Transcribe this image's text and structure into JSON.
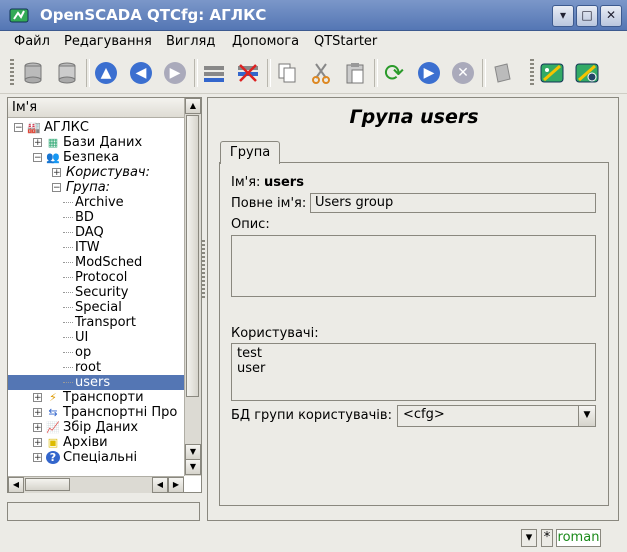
{
  "window": {
    "title": "OpenSCADA QTCfg: АГЛКС",
    "buttons": [
      "▾",
      "□",
      "✕"
    ]
  },
  "menu": [
    "Файл",
    "Редагування",
    "Вигляд",
    "Допомога",
    "QTStarter"
  ],
  "toolbar": {
    "icons": [
      "db-load-icon",
      "db-save-icon",
      "up-icon",
      "back-icon",
      "forward-icon",
      "add-item-icon",
      "delete-item-icon",
      "copy-icon",
      "cut-icon",
      "paste-icon",
      "refresh-icon",
      "start-icon",
      "stop-icon",
      "help-icon",
      "qtstarter-icon",
      "qtcfg-icon"
    ]
  },
  "tree": {
    "header": "Ім'я",
    "items": [
      {
        "label": "АГЛКС",
        "level": 0,
        "expander": "−",
        "icon": "station-icon",
        "italic": false,
        "selected": false
      },
      {
        "label": "Бази Даних",
        "level": 1,
        "expander": "+",
        "icon": "database-icon",
        "italic": false,
        "selected": false
      },
      {
        "label": "Безпека",
        "level": 1,
        "expander": "−",
        "icon": "security-icon",
        "italic": false,
        "selected": false
      },
      {
        "label": "Користувач:",
        "level": 2,
        "expander": "+",
        "icon": "",
        "italic": true,
        "selected": false
      },
      {
        "label": "Група:",
        "level": 2,
        "expander": "−",
        "icon": "",
        "italic": true,
        "selected": false
      },
      {
        "label": "Archive",
        "level": 3,
        "expander": "",
        "icon": "",
        "italic": false,
        "selected": false
      },
      {
        "label": "BD",
        "level": 3,
        "expander": "",
        "icon": "",
        "italic": false,
        "selected": false
      },
      {
        "label": "DAQ",
        "level": 3,
        "expander": "",
        "icon": "",
        "italic": false,
        "selected": false
      },
      {
        "label": "ITW",
        "level": 3,
        "expander": "",
        "icon": "",
        "italic": false,
        "selected": false
      },
      {
        "label": "ModSched",
        "level": 3,
        "expander": "",
        "icon": "",
        "italic": false,
        "selected": false
      },
      {
        "label": "Protocol",
        "level": 3,
        "expander": "",
        "icon": "",
        "italic": false,
        "selected": false
      },
      {
        "label": "Security",
        "level": 3,
        "expander": "",
        "icon": "",
        "italic": false,
        "selected": false
      },
      {
        "label": "Special",
        "level": 3,
        "expander": "",
        "icon": "",
        "italic": false,
        "selected": false
      },
      {
        "label": "Transport",
        "level": 3,
        "expander": "",
        "icon": "",
        "italic": false,
        "selected": false
      },
      {
        "label": "UI",
        "level": 3,
        "expander": "",
        "icon": "",
        "italic": false,
        "selected": false
      },
      {
        "label": "op",
        "level": 3,
        "expander": "",
        "icon": "",
        "italic": false,
        "selected": false
      },
      {
        "label": "root",
        "level": 3,
        "expander": "",
        "icon": "",
        "italic": false,
        "selected": false
      },
      {
        "label": "users",
        "level": 3,
        "expander": "",
        "icon": "",
        "italic": false,
        "selected": true
      },
      {
        "label": "Транспорти",
        "level": 1,
        "expander": "+",
        "icon": "transport-icon",
        "italic": false,
        "selected": false
      },
      {
        "label": "Транспортні Про",
        "level": 1,
        "expander": "+",
        "icon": "protocol-icon",
        "italic": false,
        "selected": false
      },
      {
        "label": "Збір Даних",
        "level": 1,
        "expander": "+",
        "icon": "daq-icon",
        "italic": false,
        "selected": false
      },
      {
        "label": "Архіви",
        "level": 1,
        "expander": "+",
        "icon": "archive-icon",
        "italic": false,
        "selected": false
      },
      {
        "label": "Спеціальні",
        "level": 1,
        "expander": "+",
        "icon": "special-icon",
        "italic": false,
        "selected": false
      }
    ]
  },
  "page": {
    "title": "Група users",
    "tab": "Група",
    "name_label": "Ім'я:",
    "name_value": "users",
    "fullname_label": "Повне ім'я:",
    "fullname_value": "Users group",
    "description_label": "Опис:",
    "description_value": "",
    "users_label": "Користувачі:",
    "users": [
      "test",
      "user"
    ],
    "db_label": "БД групи користувачів:",
    "db_value": "<cfg>"
  },
  "status": {
    "star": "*",
    "user": "roman",
    "user_color": "#1a8a1a"
  }
}
